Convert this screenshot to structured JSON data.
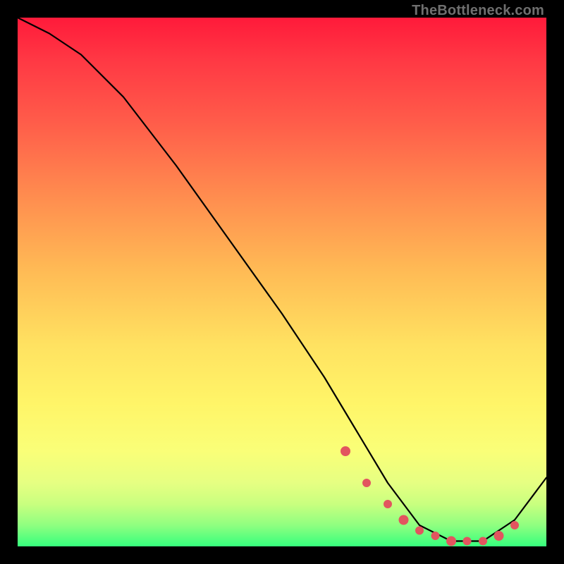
{
  "watermark": "TheBottleneck.com",
  "colors": {
    "curve_stroke": "#000000",
    "marker_fill": "#e2555f",
    "marker_stroke": "#e2555f"
  },
  "chart_data": {
    "type": "line",
    "title": "",
    "xlabel": "",
    "ylabel": "",
    "xlim": [
      0,
      100
    ],
    "ylim": [
      0,
      100
    ],
    "grid": false,
    "series": [
      {
        "name": "bottleneck-curve",
        "x": [
          0,
          6,
          12,
          20,
          30,
          40,
          50,
          58,
          64,
          70,
          76,
          82,
          88,
          94,
          100
        ],
        "y": [
          100,
          97,
          93,
          85,
          72,
          58,
          44,
          32,
          22,
          12,
          4,
          1,
          1,
          5,
          13
        ]
      }
    ],
    "markers": {
      "name": "highlight-dots",
      "x": [
        62,
        66,
        70,
        73,
        76,
        79,
        82,
        85,
        88,
        91,
        94
      ],
      "y": [
        18,
        12,
        8,
        5,
        3,
        2,
        1,
        1,
        1,
        2,
        4
      ]
    }
  }
}
